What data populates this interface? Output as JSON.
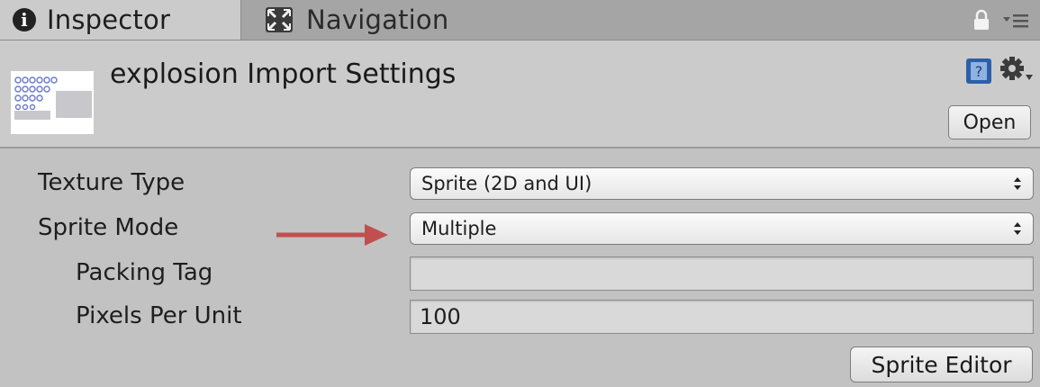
{
  "tabs": [
    {
      "label": "Inspector",
      "icon": "info-icon",
      "active": true
    },
    {
      "label": "Navigation",
      "icon": "navigation-icon",
      "active": false
    }
  ],
  "header": {
    "title": "explosion Import Settings",
    "open_label": "Open"
  },
  "settings": {
    "texture_type": {
      "label": "Texture Type",
      "value": "Sprite (2D and UI)"
    },
    "sprite_mode": {
      "label": "Sprite Mode",
      "value": "Multiple"
    },
    "packing_tag": {
      "label": "Packing Tag",
      "value": ""
    },
    "pixels_per_unit": {
      "label": "Pixels Per Unit",
      "value": "100"
    }
  },
  "sprite_editor_label": "Sprite Editor",
  "colors": {
    "arrow": "#c0504d",
    "panel": "#c2c2c2",
    "header": "#cbcbcb"
  }
}
